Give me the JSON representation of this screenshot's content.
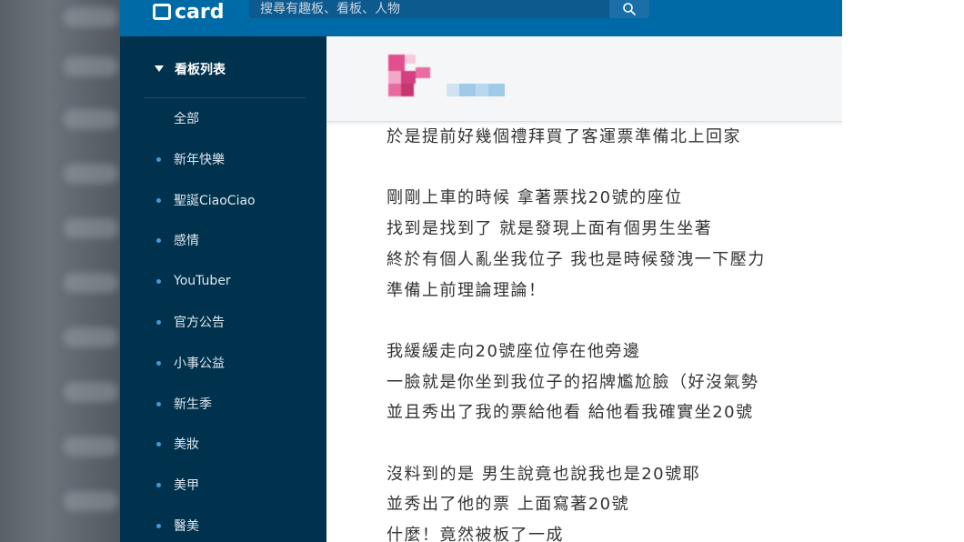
{
  "colors": {
    "topbar": "#006aa6",
    "sidebar": "#00324e",
    "sidebar_dot": "#3f9bd8",
    "post_text": "#333333"
  },
  "topbar": {
    "logo_text": "card",
    "search_placeholder": "搜尋有趣板、看板、人物",
    "search_icon": "search-icon"
  },
  "sidebar": {
    "header_label": "看板列表",
    "items": [
      {
        "label": "全部",
        "dot": false
      },
      {
        "label": "新年快樂",
        "dot": true
      },
      {
        "label": "聖誕CiaoCiao",
        "dot": true
      },
      {
        "label": "感情",
        "dot": true
      },
      {
        "label": "YouTuber",
        "dot": true
      },
      {
        "label": "官方公告",
        "dot": true
      },
      {
        "label": "小事公益",
        "dot": true
      },
      {
        "label": "新生季",
        "dot": true
      },
      {
        "label": "美妝",
        "dot": true
      },
      {
        "label": "美甲",
        "dot": true
      },
      {
        "label": "醫美",
        "dot": true
      }
    ]
  },
  "post": {
    "lines": [
      "於是提前好幾個禮拜買了客運票準備北上回家",
      "",
      "剛剛上車的時候 拿著票找20號的座位",
      "找到是找到了 就是發現上面有個男生坐著",
      "終於有個人亂坐我位子 我也是時候發洩一下壓力",
      "準備上前理論理論！",
      "",
      "我緩緩走向20號座位停在他旁邊",
      "一臉就是你坐到我位子的招牌尷尬臉（好沒氣勢",
      "並且秀出了我的票給他看 給他看我確實坐20號",
      "",
      "沒料到的是 男生說竟也說我也是20號耶",
      "並秀出了他的票 上面寫著20號",
      "什麼！竟然被板了一成"
    ]
  }
}
